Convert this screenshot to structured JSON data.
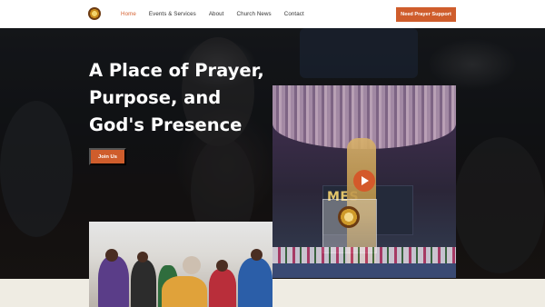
{
  "header": {
    "nav": [
      {
        "label": "Home",
        "active": true
      },
      {
        "label": "Events & Services",
        "active": false
      },
      {
        "label": "About",
        "active": false
      },
      {
        "label": "Church News",
        "active": false
      },
      {
        "label": "Contact",
        "active": false
      }
    ],
    "cta_label": "Need Prayer Support"
  },
  "hero": {
    "headline": "A Place of Prayer, Purpose, and God's Presence",
    "join_label": "Join Us"
  },
  "video": {
    "screen_text": "MES",
    "play_icon": "play-icon"
  },
  "colors": {
    "accent": "#cf5d2c",
    "nav_active": "#d5602f",
    "hero_bg": "#1f2227",
    "page_bg": "#efece3"
  }
}
